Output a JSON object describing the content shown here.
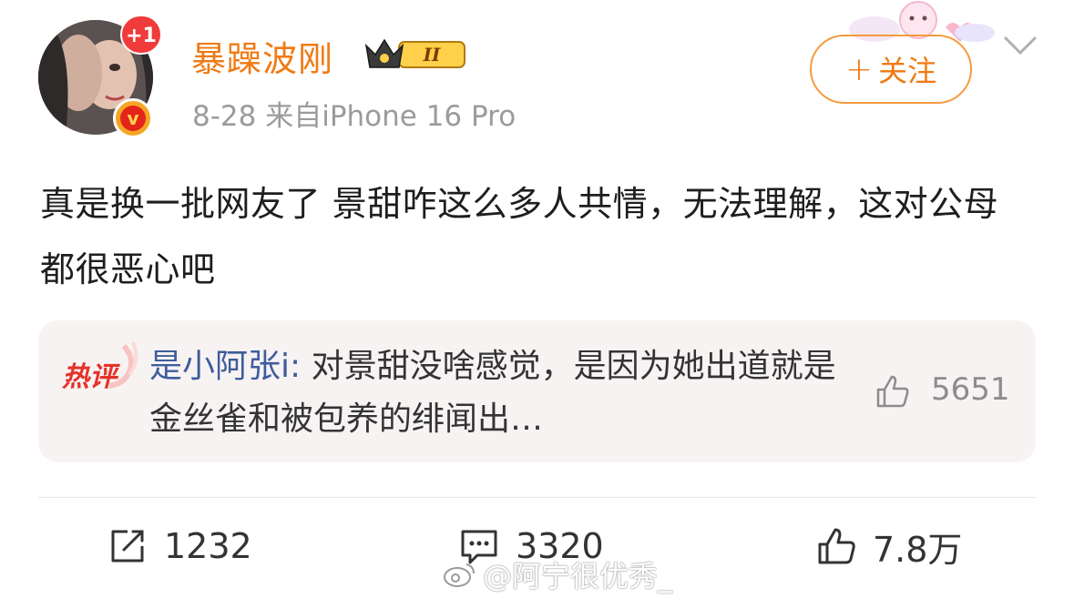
{
  "post": {
    "username": "暴躁波刚",
    "level_badge": "II",
    "notification_badge": "+1",
    "verified_mark": "v",
    "meta": "8-28  来自iPhone 16 Pro",
    "follow_label": "关注",
    "text": "真是换一批网友了 景甜咋这么多人共情，无法理解，这对公母都很恶心吧"
  },
  "hot_comment": {
    "tag": "热评",
    "author": "是小阿张i:",
    "text": " 对景甜没啥感觉，是因为她出道就是金丝雀和被包养的绯闻出…",
    "likes": "5651"
  },
  "actions": {
    "repost_count": "1232",
    "comment_count": "3320",
    "like_count": "7.8万"
  },
  "watermark": "@阿宁很优秀_",
  "colors": {
    "username": "#f07a13",
    "follow_border": "#f59a3f",
    "hot_bg": "#f8f3f3",
    "author_link": "#3e5d9b",
    "hot_tag": "#e4332a"
  }
}
